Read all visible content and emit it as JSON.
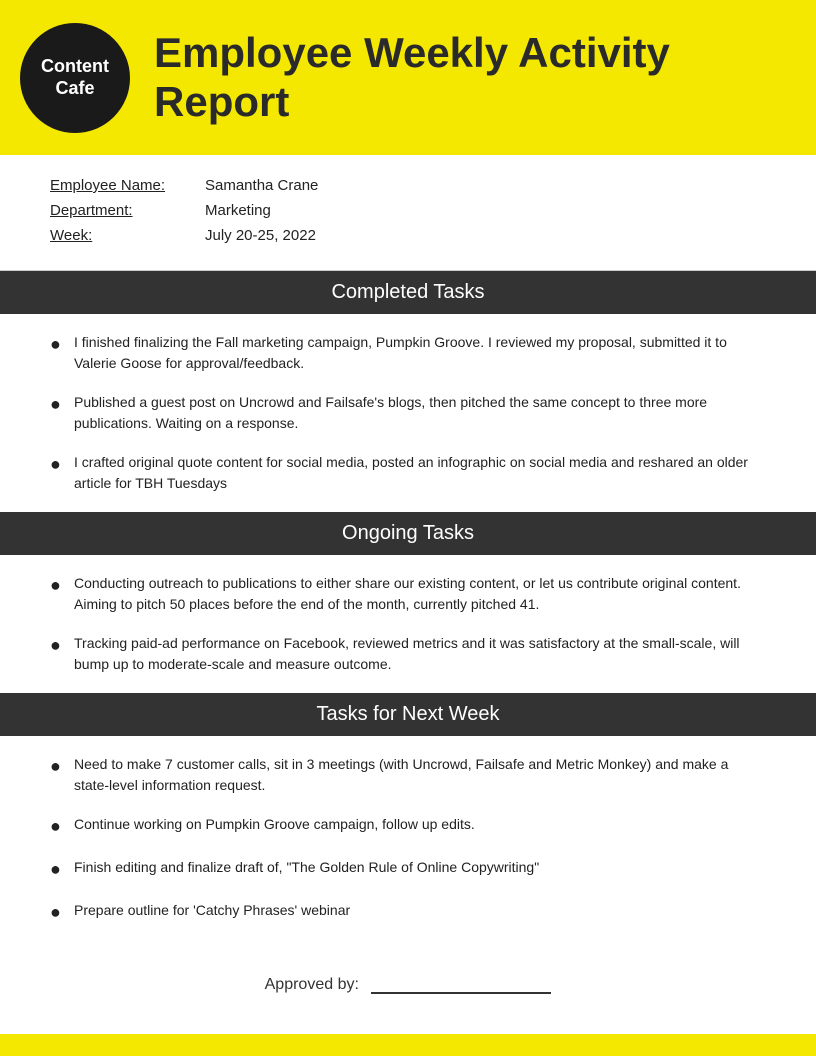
{
  "logo": {
    "line1": "Content",
    "line2": "Cafe"
  },
  "header": {
    "title": "Employee Weekly Activity Report"
  },
  "info": {
    "employee_name_label": "Employee Name:",
    "employee_name_value": "Samantha Crane",
    "department_label": "Department:",
    "department_value": "Marketing",
    "week_label": "Week:",
    "week_value": "July 20-25, 2022"
  },
  "completed_tasks": {
    "heading": "Completed Tasks",
    "items": [
      "I finished finalizing the Fall marketing campaign, Pumpkin Groove. I reviewed my proposal, submitted it to Valerie Goose for approval/feedback.",
      "Published a guest post on Uncrowd and Failsafe's blogs, then pitched the same concept to three more publications. Waiting on a response.",
      "I crafted original quote content for social media, posted an infographic on social media and reshared an older article for TBH Tuesdays"
    ]
  },
  "ongoing_tasks": {
    "heading": "Ongoing Tasks",
    "items": [
      "Conducting outreach to publications to either share our existing content, or let us contribute original content. Aiming to pitch 50 places before the end of the month, currently pitched 41.",
      "Tracking paid-ad performance on Facebook, reviewed metrics and it was satisfactory at the small-scale, will bump up to moderate-scale and measure outcome."
    ]
  },
  "next_week_tasks": {
    "heading": "Tasks for Next Week",
    "items": [
      "Need to make 7 customer calls, sit in 3 meetings (with Uncrowd, Failsafe and Metric Monkey) and make a state-level information request.",
      "Continue working on Pumpkin Groove campaign, follow up edits.",
      "Finish editing and finalize draft of, \"The Golden Rule of Online Copywriting\"",
      "Prepare outline for 'Catchy Phrases' webinar"
    ]
  },
  "approved": {
    "label": "Approved by:"
  }
}
